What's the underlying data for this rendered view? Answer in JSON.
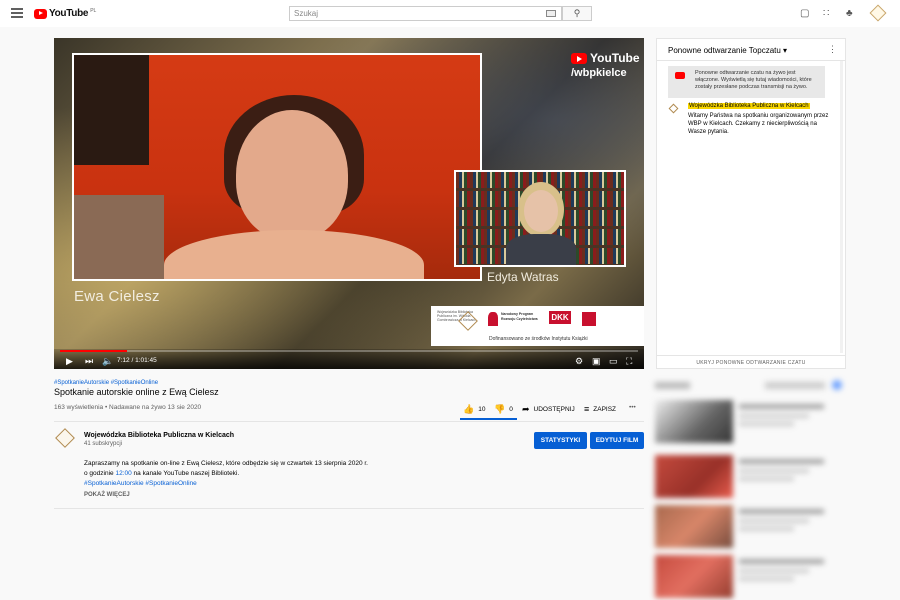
{
  "header": {
    "logo_text": "YouTube",
    "logo_country": "PL",
    "search_placeholder": "Szukaj",
    "icons": [
      "menu-icon",
      "keyboard-icon",
      "search-icon",
      "create-video-icon",
      "apps-icon",
      "notifications-icon",
      "account-avatar"
    ]
  },
  "player": {
    "watermark_line1": "YouTube",
    "watermark_line2": "/wbpkielce",
    "speaker_main": "Ewa Cielesz",
    "speaker_second": "Edyta Watras",
    "sponsor_caption": "Dofinansowano ze środków Instytutu Książki",
    "sponsor_org1": "Wojewódzka Biblioteka Publiczna im. Witolda Gombrowicza w Kielcach",
    "sponsor_org2": "Narodowy Program Rozwoju Czytelnictwa",
    "sponsor_org3": "DKK",
    "time_label": "7:12 / 1:01:45",
    "progress": 0.116,
    "accent_color": "#ff0000"
  },
  "video": {
    "hashtags": "#SpotkanieAutorskie #SpotkanieOnline",
    "title": "Spotkanie autorskie online z Ewą Cielesz",
    "meta": "163 wyświetlenia • Nadawane na żywo 13 sie 2020",
    "likes": "10",
    "dislikes": "0",
    "like_ratio": 1.0,
    "share_label": "UDOSTĘPNIJ",
    "save_label": "ZAPISZ",
    "more_label": "•••"
  },
  "channel": {
    "name": "Wojewódzka Biblioteka Publiczna w Kielcach",
    "subscribers": "41 subskrypcji",
    "stats_button": "STATYSTYKI",
    "edit_button": "EDYTUJ FILM"
  },
  "description": {
    "line1": "Zapraszamy na spotkanie on-line z Ewą Cielesz, które odbędzie się w czwartek 13 sierpnia 2020 r.",
    "line2_pre": "o godzinie ",
    "line2_time": "12:00",
    "line2_post": " na kanale YouTube naszej Biblioteki.",
    "line3": "#SpotkanieAutorskie #SpotkanieOnline",
    "show_more": "POKAŻ WIĘCEJ"
  },
  "chat": {
    "title": "Ponowne odtwarzanie Topczatu ▾",
    "system_message": "Ponowne odtwarzanie czatu na żywo jest włączone. Wyświetlą się tutaj wiadomości, które zostały przesłane podczas transmisji na żywo.",
    "message_author": "Wojewódzka Biblioteka Publiczna w Kielcach",
    "message_text": "Witamy Państwa na spotkaniu organizowanym przez WBP w Kielcach. Czekamy z niecierpliwością na Wasze pytania.",
    "hide_button": "UKRYJ PONOWNE ODTWARZANIE CZATU"
  },
  "colors": {
    "link": "#065fd4",
    "highlight": "#f8d600",
    "button_blue": "#065fd4"
  }
}
